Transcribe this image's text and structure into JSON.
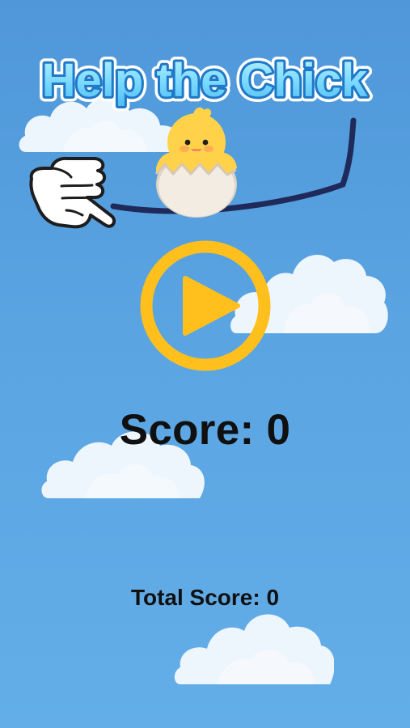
{
  "game": {
    "title": "Help the Chick",
    "score_label": "Score:",
    "score_value": "0",
    "total_score_label": "Total Score:",
    "total_score_value": "0"
  },
  "controls": {
    "play_button_icon": "play-icon"
  },
  "colors": {
    "background": "#5aa4e2",
    "title_fill": "#7fd7ff",
    "title_outline": "#1d77c9",
    "accent_yellow": "#ffc01d",
    "line_color": "#1f2a5a",
    "cloud": "#edf5fc"
  }
}
